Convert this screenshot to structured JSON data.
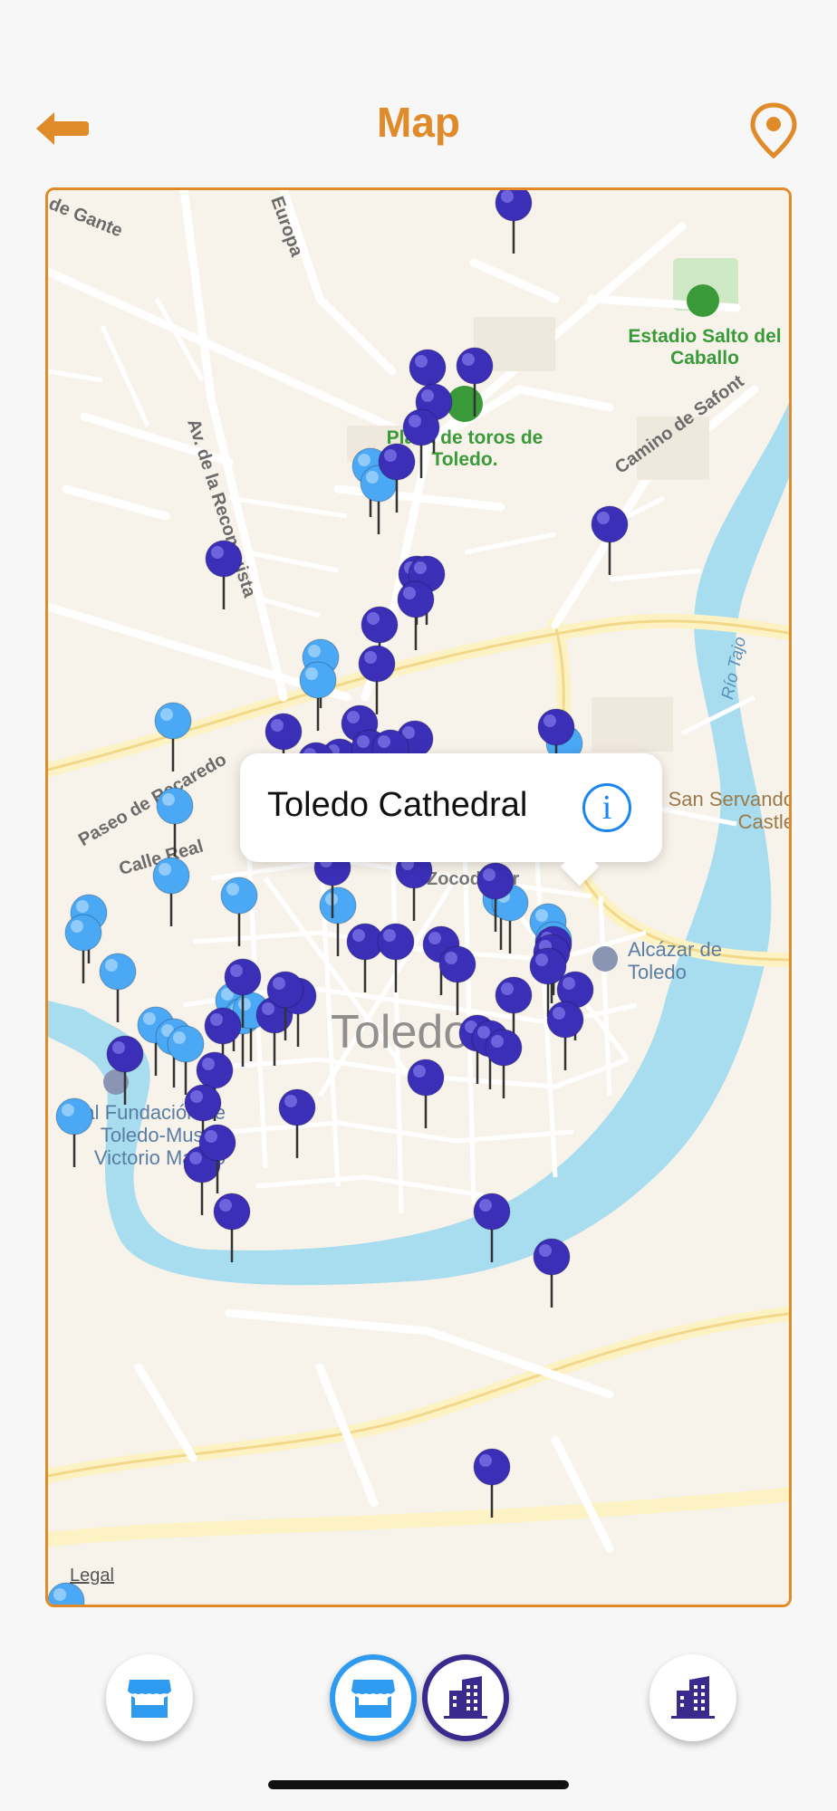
{
  "header": {
    "title": "Map",
    "back_icon": "back-arrow-icon",
    "pin_icon": "map-pin-icon"
  },
  "colors": {
    "accent": "#e08a2a",
    "pin_dark": "#3b2fb8",
    "pin_light": "#4aa8f5",
    "water": "#a8dcef",
    "info_blue": "#1a84f0"
  },
  "map": {
    "labels": {
      "stadium": "Estadio Salto del Caballo",
      "plaza": "Plaza de toros de Toledo.",
      "camino": "Camino de Safont",
      "recon": "Av. de la Reconquista",
      "europa": "Europa",
      "gante": "de Gante",
      "recaredo": "Paseo de Recaredo",
      "calle_real": "Calle Real",
      "rio": "Río Tajo",
      "san_servando": "San Servando Castle",
      "alcazar": "Alcázar de Toledo",
      "fundacion": "Real Fundación de Toledo-Museo Victorio Macho",
      "toledo": "Toledo",
      "zoco": "Zocodover"
    },
    "legal": "Legal"
  },
  "callout": {
    "title": "Toledo Cathedral",
    "info_icon": "info-icon"
  },
  "bottom_bar": {
    "buttons": [
      {
        "name": "shops-filter-button",
        "icon": "store-icon",
        "active": false
      },
      {
        "name": "shops-active-button",
        "icon": "store-icon",
        "active": true
      },
      {
        "name": "buildings-active-button",
        "icon": "building-icon",
        "active": true
      },
      {
        "name": "buildings-filter-button",
        "icon": "building-icon",
        "active": false
      }
    ]
  }
}
